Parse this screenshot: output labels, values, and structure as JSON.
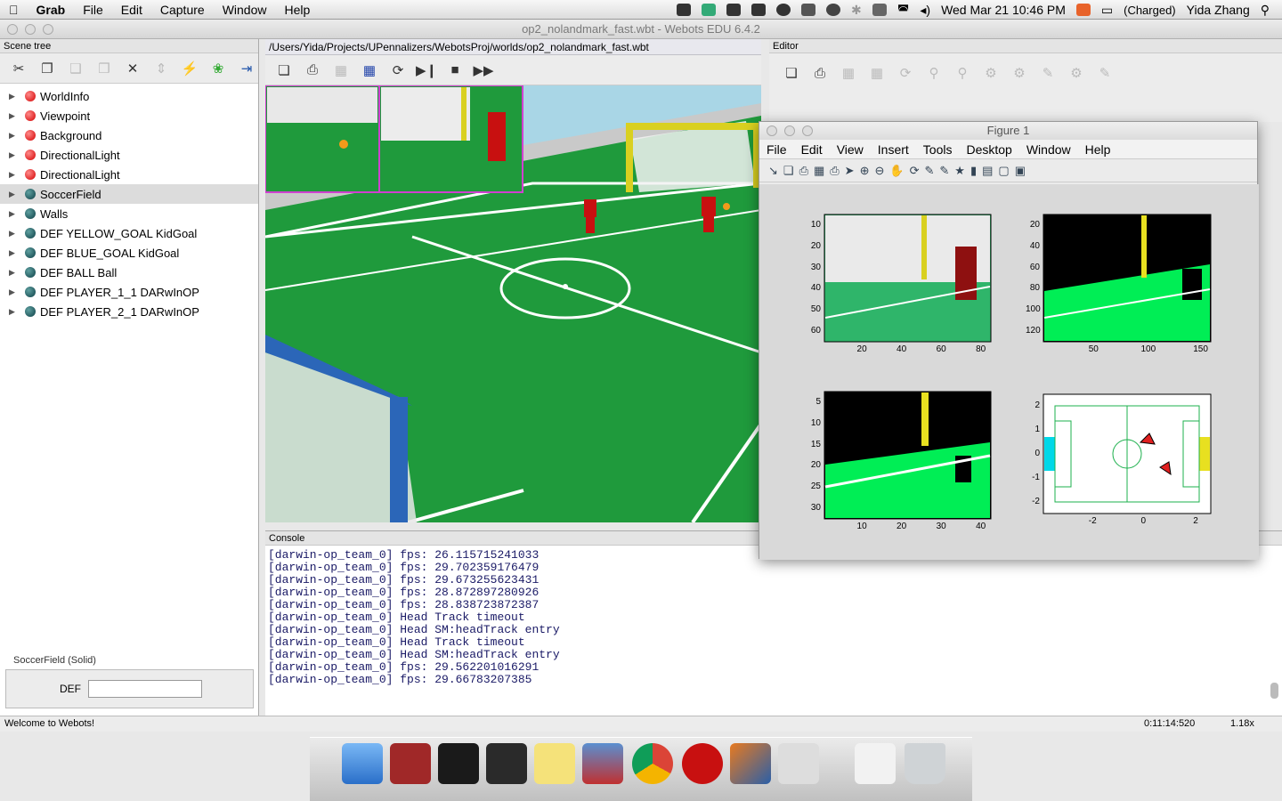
{
  "menubar": {
    "app_name": "Grab",
    "items": [
      "File",
      "Edit",
      "Capture",
      "Window",
      "Help"
    ],
    "datetime": "Wed Mar 21  10:46 PM",
    "battery": "(Charged)",
    "user": "Yida Zhang"
  },
  "window_title": "op2_nolandmark_fast.wbt - Webots EDU 6.4.2",
  "scene_tree": {
    "title": "Scene tree",
    "nodes": [
      {
        "label": "WorldInfo",
        "color": "red"
      },
      {
        "label": "Viewpoint",
        "color": "red"
      },
      {
        "label": "Background",
        "color": "red"
      },
      {
        "label": "DirectionalLight",
        "color": "red"
      },
      {
        "label": "DirectionalLight",
        "color": "red"
      },
      {
        "label": "SoccerField",
        "color": "teal"
      },
      {
        "label": "Walls",
        "color": "teal"
      },
      {
        "label": "DEF YELLOW_GOAL KidGoal",
        "color": "teal"
      },
      {
        "label": "DEF BLUE_GOAL KidGoal",
        "color": "teal"
      },
      {
        "label": "DEF BALL Ball",
        "color": "teal"
      },
      {
        "label": "DEF PLAYER_1_1 DARwInOP",
        "color": "teal"
      },
      {
        "label": "DEF PLAYER_2_1 DARwInOP",
        "color": "teal"
      }
    ],
    "field_group_label": "SoccerField (Solid)",
    "def_label": "DEF",
    "def_value": ""
  },
  "view": {
    "path": "/Users/Yida/Projects/UPennalizers/WebotsProj/worlds/op2_nolandmark_fast.wbt"
  },
  "editor": {
    "title": "Editor"
  },
  "console": {
    "title": "Console",
    "lines": [
      "[darwin-op_team_0] fps: 26.115715241033",
      "[darwin-op_team_0] fps: 29.702359176479",
      "[darwin-op_team_0] fps: 29.673255623431",
      "[darwin-op_team_0] fps: 28.872897280926",
      "[darwin-op_team_0] fps: 28.838723872387",
      "[darwin-op_team_0] Head Track timeout",
      "[darwin-op_team_0] Head SM:headTrack entry",
      "[darwin-op_team_0] Head Track timeout",
      "[darwin-op_team_0] Head SM:headTrack entry",
      "[darwin-op_team_0] fps: 29.562201016291",
      "[darwin-op_team_0] fps: 29.66783207385"
    ]
  },
  "statusbar": {
    "message": "Welcome to Webots!",
    "time": "0:11:14:520",
    "speed": "1.18x"
  },
  "figure": {
    "title": "Figure 1",
    "menu": [
      "File",
      "Edit",
      "View",
      "Insert",
      "Tools",
      "Desktop",
      "Window",
      "Help"
    ],
    "plots": [
      {
        "yticks": [
          "10",
          "20",
          "30",
          "40",
          "50",
          "60"
        ],
        "xticks": [
          "20",
          "40",
          "60",
          "80"
        ]
      },
      {
        "yticks": [
          "20",
          "40",
          "60",
          "80",
          "100",
          "120"
        ],
        "xticks": [
          "50",
          "100",
          "150"
        ]
      },
      {
        "yticks": [
          "5",
          "10",
          "15",
          "20",
          "25",
          "30"
        ],
        "xticks": [
          "10",
          "20",
          "30",
          "40"
        ]
      },
      {
        "yticks": [
          "2",
          "1",
          "0",
          "-1",
          "-2"
        ],
        "xticks": [
          "-2",
          "0",
          "2"
        ]
      }
    ]
  },
  "colors": {
    "field": "#1f9a3c",
    "sky": "#a9d6e6",
    "robot": "#c81010",
    "goal": "#d9d020",
    "field_bin": "#00ee55"
  }
}
